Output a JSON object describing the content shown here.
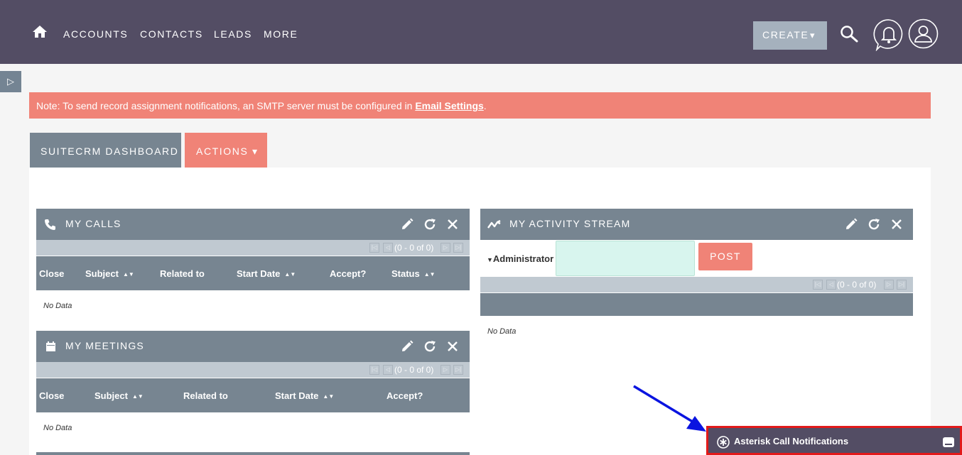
{
  "nav": {
    "items": [
      "ACCOUNTS",
      "CONTACTS",
      "LEADS",
      "MORE"
    ],
    "create_label": "CREATE",
    "create_caret": "▾"
  },
  "notice": {
    "text": "Note: To send record assignment notifications, an SMTP server must be configured in ",
    "link": "Email Settings",
    "suffix": "."
  },
  "dashboard": {
    "tab_label": "SUITECRM DASHBOARD",
    "actions_label": "ACTIONS",
    "actions_caret": "▾"
  },
  "my_calls": {
    "title": "MY CALLS",
    "pagination": "(0 - 0 of 0)",
    "columns": [
      "Close",
      "Subject",
      "Related to",
      "Start Date",
      "Accept?",
      "Status"
    ],
    "no_data": "No Data"
  },
  "my_meetings": {
    "title": "MY MEETINGS",
    "pagination": "(0 - 0 of 0)",
    "columns": [
      "Close",
      "Subject",
      "Related to",
      "Start Date",
      "Accept?"
    ],
    "no_data": "No Data"
  },
  "activity_stream": {
    "title": "MY ACTIVITY STREAM",
    "user": "Administrator",
    "post_label": "POST",
    "pagination": "(0 - 0 of 0)",
    "no_data": "No Data"
  },
  "asterisk": {
    "label": "Asterisk Call Notifications"
  },
  "colors": {
    "topbar": "#534d64",
    "dashlet_header": "#778591",
    "accent": "#f08377",
    "highlight_border": "#e21a1a",
    "annotation_arrow": "#0a14e0"
  },
  "icons": {
    "nav": [
      "home-icon",
      "search-icon",
      "bell-icon",
      "user-icon"
    ],
    "dashlet": [
      "phone-icon",
      "calendar-icon",
      "activity-icon",
      "pencil-icon",
      "refresh-icon",
      "close-icon"
    ]
  }
}
